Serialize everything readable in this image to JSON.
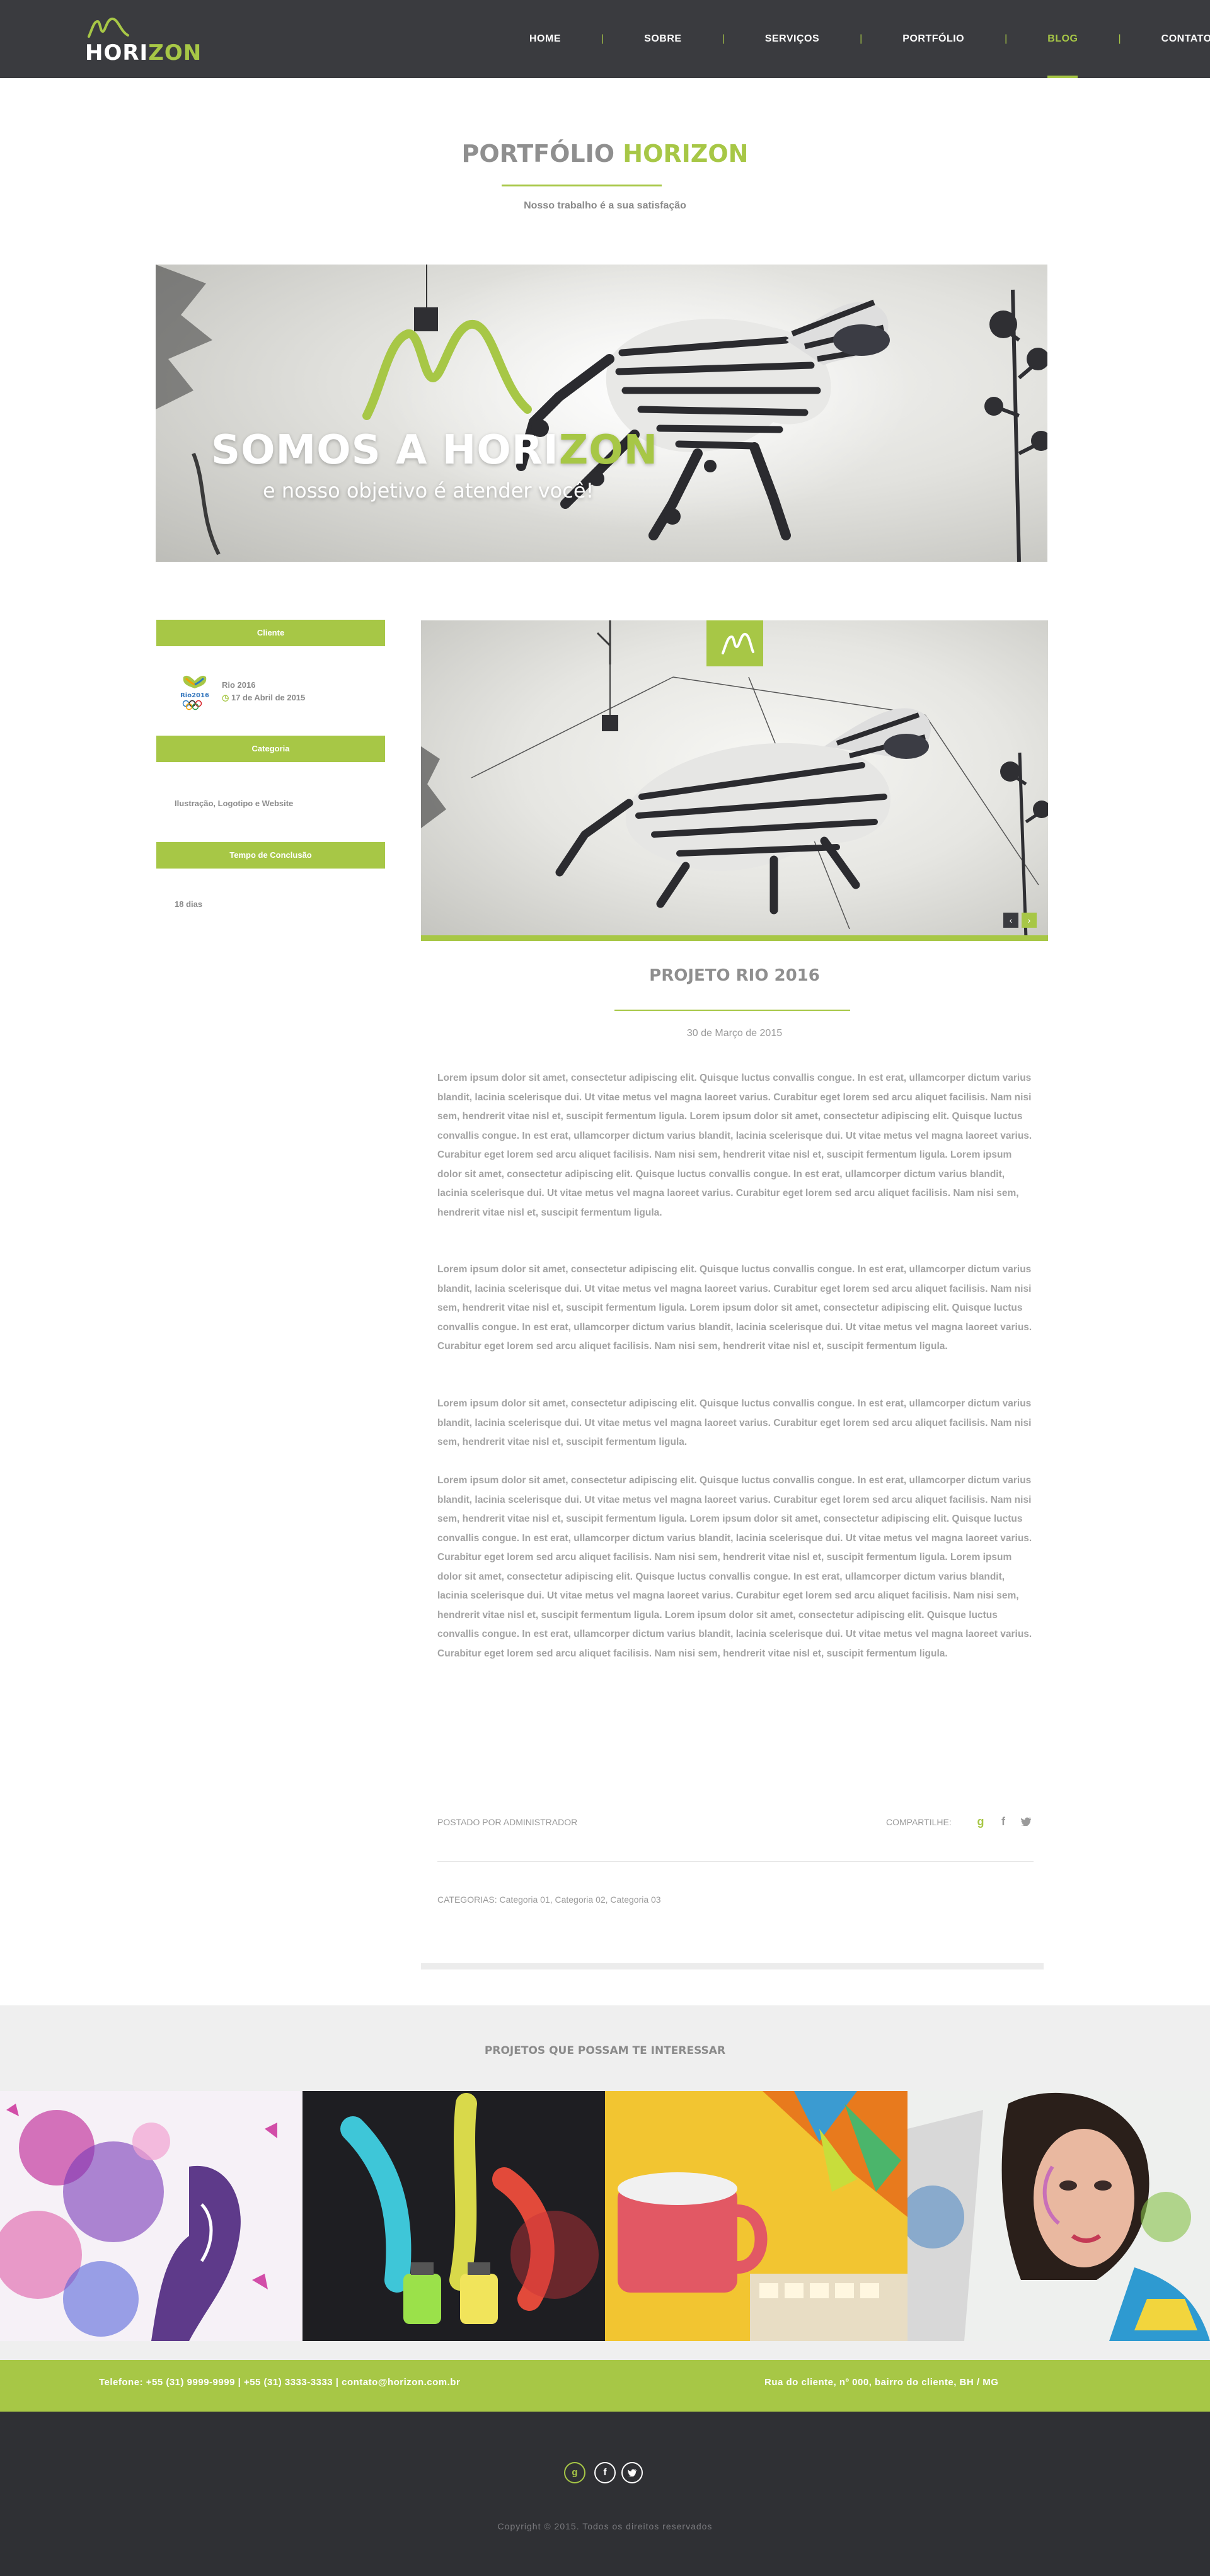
{
  "brand": {
    "logo_prefix": "HOR",
    "logo_i": "I",
    "logo_suffix": "ZON",
    "accent": "#a7c746",
    "dark": "#3a3b3f"
  },
  "nav": {
    "items": [
      "HOME",
      "SOBRE",
      "SERVIÇOS",
      "PORTFÓLIO",
      "BLOG",
      "CONTATO"
    ],
    "active": "BLOG"
  },
  "page": {
    "title_main": "PORTFÓLIO",
    "title_accent": "HORIZON",
    "subtitle": "Nosso trabalho é a sua satisfação"
  },
  "hero": {
    "headline_main": "SOMOS A HORI",
    "headline_accent": "ZON",
    "tagline": "e nosso objetivo é atender você!"
  },
  "sidebar": {
    "client_heading": "Cliente",
    "client_name": "Rio 2016",
    "client_date": "17 de Abril de 2015",
    "category_heading": "Categoria",
    "category_text": "Ilustração, Logotipo e Website",
    "time_heading": "Tempo de Conclusão",
    "time_text": "18 dias"
  },
  "project": {
    "title": "PROJETO RIO 2016",
    "date": "30 de Março de 2015",
    "paragraphs": [
      "Lorem ipsum dolor sit amet, consectetur adipiscing elit. Quisque luctus convallis congue. In est erat, ullamcorper dictum varius blandit, lacinia scelerisque dui. Ut vitae metus vel magna laoreet varius. Curabitur eget lorem sed arcu aliquet facilisis. Nam nisi sem, hendrerit vitae nisl et, suscipit fermentum ligula. Lorem ipsum dolor sit amet, consectetur adipiscing elit. Quisque luctus convallis congue. In est erat, ullamcorper dictum varius blandit, lacinia scelerisque dui. Ut vitae metus vel magna laoreet varius. Curabitur eget lorem sed arcu aliquet facilisis. Nam nisi sem, hendrerit vitae nisl et, suscipit fermentum ligula. Lorem ipsum dolor sit amet, consectetur adipiscing elit. Quisque luctus convallis congue. In est erat, ullamcorper dictum varius blandit, lacinia scelerisque dui. Ut vitae metus vel magna laoreet varius. Curabitur eget lorem sed arcu aliquet facilisis. Nam nisi sem, hendrerit vitae nisl et, suscipit fermentum ligula.",
      "Lorem ipsum dolor sit amet, consectetur adipiscing elit. Quisque luctus convallis congue. In est erat, ullamcorper dictum varius blandit, lacinia scelerisque dui. Ut vitae metus vel magna laoreet varius. Curabitur eget lorem sed arcu aliquet facilisis. Nam nisi sem, hendrerit vitae nisl et, suscipit fermentum ligula. Lorem ipsum dolor sit amet, consectetur adipiscing elit. Quisque luctus convallis congue. In est erat, ullamcorper dictum varius blandit, lacinia scelerisque dui. Ut vitae metus vel magna laoreet varius. Curabitur eget lorem sed arcu aliquet facilisis. Nam nisi sem, hendrerit vitae nisl et, suscipit fermentum ligula.",
      "Lorem ipsum dolor sit amet, consectetur adipiscing elit. Quisque luctus convallis congue. In est erat, ullamcorper dictum varius blandit, lacinia scelerisque dui. Ut vitae metus vel magna laoreet varius. Curabitur eget lorem sed arcu aliquet facilisis. Nam nisi sem, hendrerit vitae nisl et, suscipit fermentum ligula.",
      "Lorem ipsum dolor sit amet, consectetur adipiscing elit. Quisque luctus convallis congue. In est erat, ullamcorper dictum varius blandit, lacinia scelerisque dui. Ut vitae metus vel magna laoreet varius. Curabitur eget lorem sed arcu aliquet facilisis. Nam nisi sem, hendrerit vitae nisl et, suscipit fermentum ligula. Lorem ipsum dolor sit amet, consectetur adipiscing elit. Quisque luctus convallis congue. In est erat, ullamcorper dictum varius blandit, lacinia scelerisque dui. Ut vitae metus vel magna laoreet varius. Curabitur eget lorem sed arcu aliquet facilisis. Nam nisi sem, hendrerit vitae nisl et, suscipit fermentum ligula. Lorem ipsum dolor sit amet, consectetur adipiscing elit. Quisque luctus convallis congue. In est erat, ullamcorper dictum varius blandit, lacinia scelerisque dui. Ut vitae metus vel magna laoreet varius. Curabitur eget lorem sed arcu aliquet facilisis. Nam nisi sem, hendrerit vitae nisl et, suscipit fermentum ligula. Lorem ipsum dolor sit amet, consectetur adipiscing elit. Quisque luctus convallis congue. In est erat, ullamcorper dictum varius blandit, lacinia scelerisque dui. Ut vitae metus vel magna laoreet varius. Curabitur eget lorem sed arcu aliquet facilisis. Nam nisi sem, hendrerit vitae nisl et, suscipit fermentum ligula."
    ],
    "posted_by": "POSTADO POR ADMINISTRADOR",
    "share_label": "COMPARTILHE:",
    "categories": "CATEGORIAS: Categoria 01, Categoria 02, Categoria 03"
  },
  "related": {
    "title": "PROJETOS QUE POSSAM TE INTERESSAR"
  },
  "footer": {
    "contact_left": "Telefone: +55 (31) 9999-9999  |  +55 (31) 3333-3333  |  contato@horizon.com.br",
    "contact_right": "Rua do cliente, nº 000, bairro do cliente, BH / MG",
    "copyright": "Copyright © 2015. Todos os direitos reservados"
  },
  "icons": {
    "share": [
      "google-plus-icon",
      "facebook-icon",
      "twitter-icon"
    ],
    "footer_social": [
      "google-plus-icon",
      "facebook-icon",
      "twitter-icon"
    ],
    "slider": [
      "chevron-left-icon",
      "chevron-right-icon"
    ]
  }
}
